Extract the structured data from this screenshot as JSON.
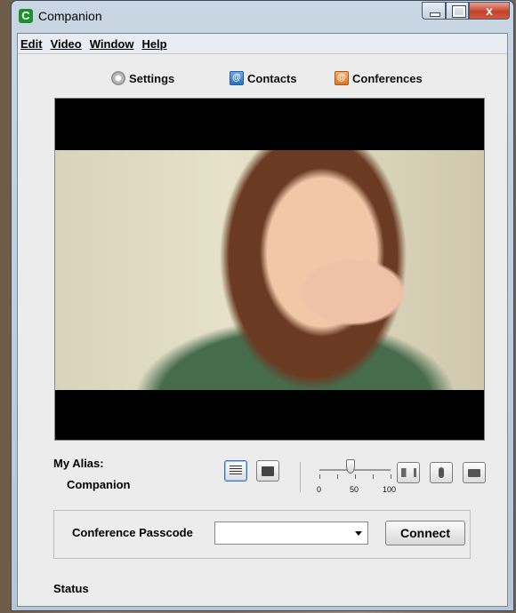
{
  "window": {
    "title": "Companion",
    "close_glyph": "x"
  },
  "menu": {
    "items": [
      "Edit",
      "Video",
      "Window",
      "Help"
    ]
  },
  "toolbar": {
    "settings": "Settings",
    "contacts": "Contacts",
    "conferences": "Conferences"
  },
  "alias": {
    "label": "My Alias:",
    "value": "Companion"
  },
  "volume": {
    "value": 50,
    "min_label": "0",
    "mid_label": "50",
    "max_label": "100"
  },
  "passcode": {
    "label": "Conference Passcode",
    "value": "",
    "connect_label": "Connect"
  },
  "status": {
    "label": "Status"
  },
  "icons": [
    "app-icon",
    "minimize-icon",
    "maximize-icon",
    "close-icon",
    "gear-icon",
    "contacts-icon",
    "conferences-icon",
    "list-view-icon",
    "photo-view-icon",
    "speaker-icon",
    "microphone-icon",
    "video-camera-icon",
    "dropdown-arrow-icon"
  ]
}
